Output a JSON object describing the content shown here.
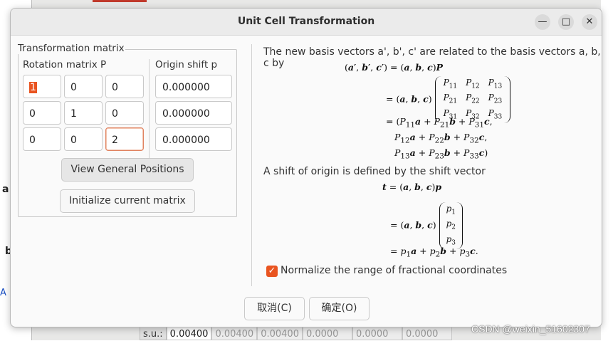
{
  "background": {
    "letters": [
      "a",
      "b",
      "A"
    ],
    "table": [
      "s.u.:",
      "0.00400",
      "0.00400",
      "0.00400",
      "0.0000",
      "0.0000",
      "0.0000"
    ],
    "accent_color": "#c0392b"
  },
  "watermark": "CSDN @weixin_51602307",
  "dialog": {
    "title": "Unit Cell Transformation",
    "window_buttons": {
      "minimize": "—",
      "maximize": "□",
      "close": "✕"
    },
    "matrix_group": {
      "title": "Transformation matrix",
      "rotation_label": "Rotation matrix P",
      "origin_label": "Origin shift p",
      "rows": [
        [
          "1",
          "0",
          "0"
        ],
        [
          "0",
          "1",
          "0"
        ],
        [
          "0",
          "0",
          "2"
        ]
      ],
      "origin_shift": [
        "0.000000",
        "0.000000",
        "0.000000"
      ],
      "view_general_positions": "View General Positions",
      "initialize_matrix": "Initialize current matrix"
    },
    "description": {
      "basis_text": "The new basis vectors a', b', c' are related to the basis vectors a, b, c by",
      "shift_text": "A shift of origin is defined by the shift vector"
    },
    "normalize_label": "Normalize the range of fractional coordinates",
    "normalize_checked": true,
    "cancel_label": "取消(C)",
    "ok_label": "确定(O)",
    "accent_color": "#e95420"
  }
}
